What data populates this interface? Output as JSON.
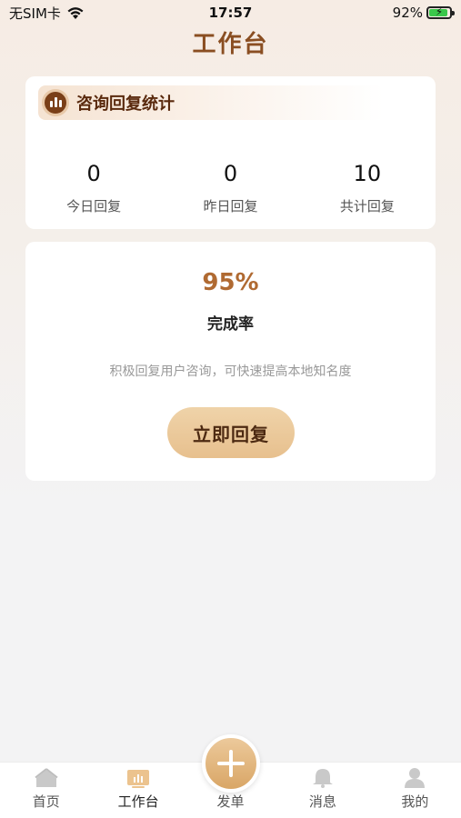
{
  "status_bar": {
    "carrier": "无SIM卡",
    "time": "17:57",
    "battery_percent": "92%",
    "battery_level": 0.92
  },
  "header": {
    "title": "工作台"
  },
  "stats": {
    "title": "咨询回复统计",
    "items": [
      {
        "value": "0",
        "label": "今日回复"
      },
      {
        "value": "0",
        "label": "昨日回复"
      },
      {
        "value": "10",
        "label": "共计回复"
      }
    ]
  },
  "completion": {
    "rate": "95%",
    "label": "完成率",
    "description": "积极回复用户咨询，可快速提高本地知名度",
    "button_label": "立即回复"
  },
  "tab_bar": {
    "items": [
      {
        "label": "首页",
        "icon": "home-icon"
      },
      {
        "label": "工作台",
        "icon": "chart-icon"
      },
      {
        "label": "发单",
        "icon": "plus-icon"
      },
      {
        "label": "消息",
        "icon": "bell-icon"
      },
      {
        "label": "我的",
        "icon": "user-icon"
      }
    ],
    "active_index": 1
  },
  "colors": {
    "accent": "#8a4e22",
    "rate": "#b06a32",
    "button": "#e7c08e"
  }
}
